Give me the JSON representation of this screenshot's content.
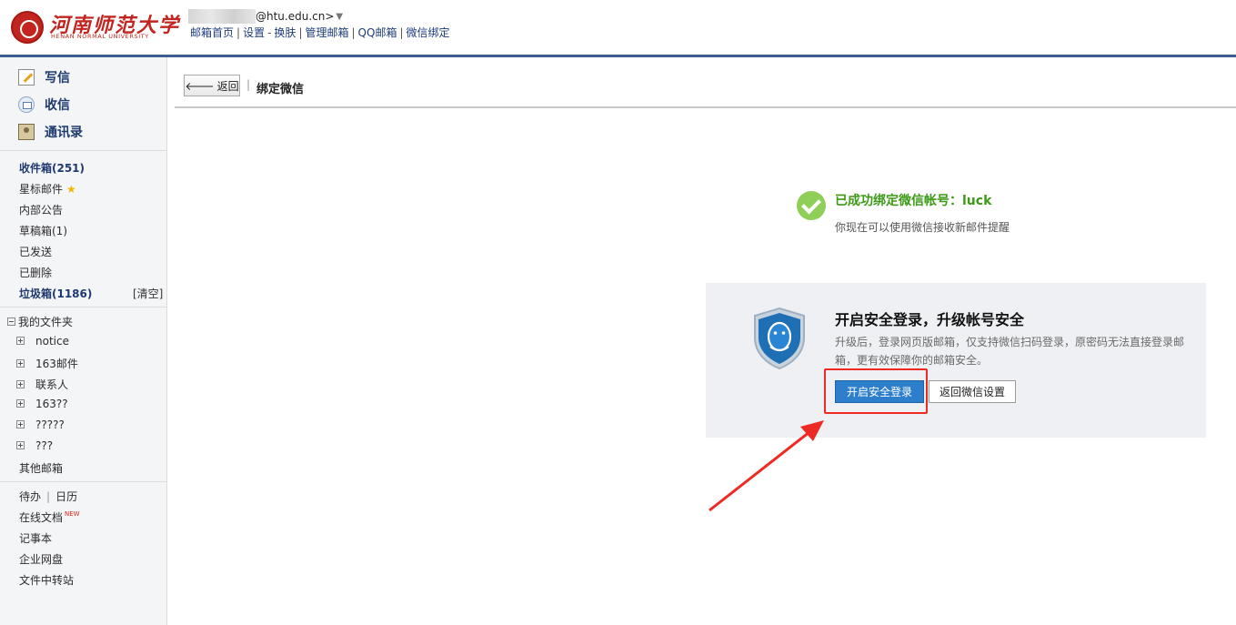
{
  "header": {
    "logo": {
      "name_cn": "河南师范大学",
      "name_en": "HENAN NORMAL UNIVERSITY"
    },
    "account_suffix": "@htu.edu.cn>",
    "caret": "▼",
    "links": [
      "邮箱首页",
      "设置",
      "换肤",
      "管理邮箱",
      "QQ邮箱",
      "微信绑定"
    ],
    "link_sep": "|",
    "skin_sep": "-"
  },
  "sidebar": {
    "compose": "写信",
    "receive": "收信",
    "contacts": "通讯录",
    "folders": {
      "inbox": "收件箱(251)",
      "starred": "星标邮件",
      "notice": "内部公告",
      "drafts": "草稿箱(1)",
      "sent": "已发送",
      "deleted": "已删除",
      "spam": "垃圾箱(1186)",
      "spam_clear": "[清空]"
    },
    "my_folders": {
      "label": "我的文件夹",
      "items": [
        "notice",
        "163邮件",
        "联系人",
        "163??",
        "?????",
        "???"
      ]
    },
    "other_mail": "其他邮箱",
    "tools": {
      "todo": "待办",
      "sep": "|",
      "calendar": "日历",
      "online_docs": "在线文档",
      "new_badge": "NEW",
      "notes": "记事本",
      "netdisk": "企业网盘",
      "transfer": "文件中转站"
    }
  },
  "main": {
    "back_label": "返回",
    "toolbar_sep": "|",
    "page_title": "绑定微信",
    "success": {
      "title": "已成功绑定微信帐号：luck",
      "subtitle": "你现在可以使用微信接收新邮件提醒"
    },
    "promo": {
      "title": "开启安全登录，升级帐号安全",
      "text": "升级后，登录网页版邮箱，仅支持微信扫码登录，原密码无法直接登录邮箱，更有效保障你的邮箱安全。",
      "primary_button": "开启安全登录",
      "secondary_button": "返回微信设置"
    }
  },
  "colors": {
    "brand_red": "#c2251f",
    "header_line": "#3b5f8f",
    "link_blue": "#1d3d7a",
    "success_green": "#3c9a17",
    "primary_button": "#2d7fcc",
    "annotation_red": "#ee2a24"
  },
  "icons": [
    "university-logo",
    "compose-icon",
    "inbox-icon",
    "contacts-icon",
    "star-icon",
    "expand-icon",
    "collapse-icon",
    "back-arrow-icon",
    "check-circle-icon",
    "qq-shield-icon"
  ]
}
